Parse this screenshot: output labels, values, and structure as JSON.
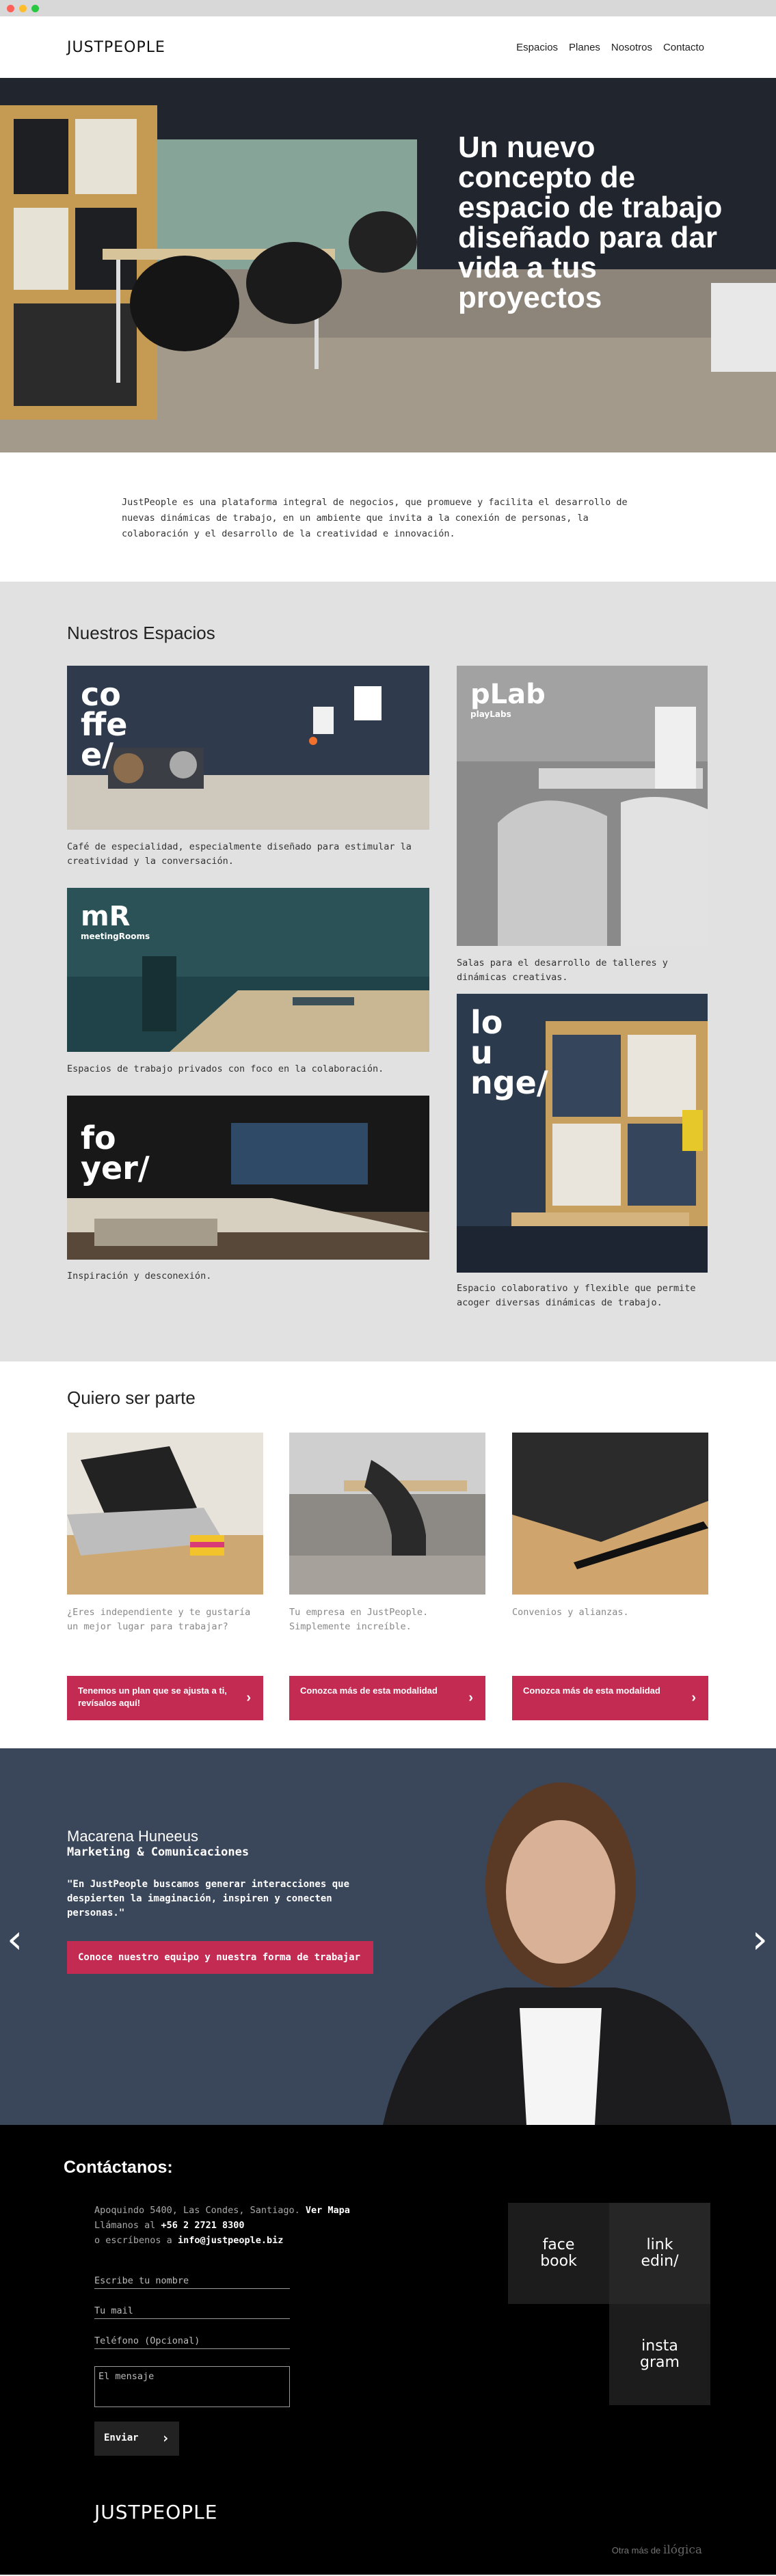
{
  "browser": {
    "dots": [
      "#ff6159",
      "#ffbd2e",
      "#28c941"
    ]
  },
  "header": {
    "logo": "JUSTPEOPLE",
    "nav": [
      "Espacios",
      "Planes",
      "Nosotros",
      "Contacto"
    ]
  },
  "hero": {
    "title": "Un nuevo concepto de espacio de trabajo diseñado para dar vida a tus proyectos"
  },
  "intro": {
    "text": "JustPeople es una plataforma integral de negocios, que promueve y facilita el desarrollo de nuevas dinámicas de trabajo, en un ambiente que invita a la conexión de personas, la colaboración y el desarrollo de la creatividad e innovación."
  },
  "spaces": {
    "title": "Nuestros Espacios",
    "items": [
      {
        "label_lines": [
          "co",
          "ffe",
          "e/"
        ],
        "sub": "",
        "desc": "Café de especialidad, especialmente diseñado para estimular la creatividad y la conversación."
      },
      {
        "label_lines": [
          "mR"
        ],
        "sub": "meetingRooms",
        "desc": "Espacios de trabajo privados con foco en la colaboración."
      },
      {
        "label_lines": [
          "fo",
          "yer/"
        ],
        "sub": "",
        "desc": "Inspiración y desconexión."
      },
      {
        "label_lines": [
          "pLab"
        ],
        "sub": "playLabs",
        "desc": "Salas para el desarrollo de talleres y dinámicas creativas."
      },
      {
        "label_lines": [
          "lo",
          "u",
          "nge/"
        ],
        "sub": "",
        "desc": "Espacio colaborativo y flexible que permite acoger diversas dinámicas de trabajo."
      }
    ]
  },
  "plans": {
    "title": "Quiero ser parte",
    "items": [
      {
        "text": "¿Eres independiente y te gustaría un mejor lugar para trabajar?",
        "button": "Tenemos un plan que se ajusta a ti, revísalos aquí!"
      },
      {
        "text": "Tu empresa en JustPeople. Simplemente increíble.",
        "button": "Conozca más de esta modalidad"
      },
      {
        "text": "Convenios y alianzas.",
        "button": "Conozca más de esta modalidad"
      }
    ]
  },
  "team": {
    "name": "Macarena Huneeus",
    "role": "Marketing & Comunicaciones",
    "quote": "\"En JustPeople buscamos generar interacciones que despierten la imaginación, inspiren y conecten personas.\"",
    "button": "Conoce nuestro equipo y nuestra forma de trabajar",
    "prev": "‹",
    "next": "›"
  },
  "contact": {
    "title": "Contáctanos:",
    "address": "Apoquindo 5400, Las Condes, Santiago.",
    "map_link": "Ver Mapa",
    "call_prefix": "Llámanos al",
    "phone": "+56 2 2721 8300",
    "mail_prefix": "o escríbenos a",
    "email": "info@justpeople.biz",
    "fields": {
      "name": "Escribe tu nombre",
      "mail": "Tu mail",
      "phone": "Teléfono (Opcional)",
      "message": "El mensaje"
    },
    "send": "Enviar",
    "social": {
      "facebook": "face\nbook",
      "linkedin": "link\nedin/",
      "instagram": "insta\ngram"
    },
    "footer_logo": "JUSTPEOPLE",
    "credit_prefix": "Otra más de",
    "credit_brand": "ilógica"
  },
  "colors": {
    "accent": "#c32b53",
    "dark": "#000000",
    "grey_bg": "#e1e1e1"
  }
}
